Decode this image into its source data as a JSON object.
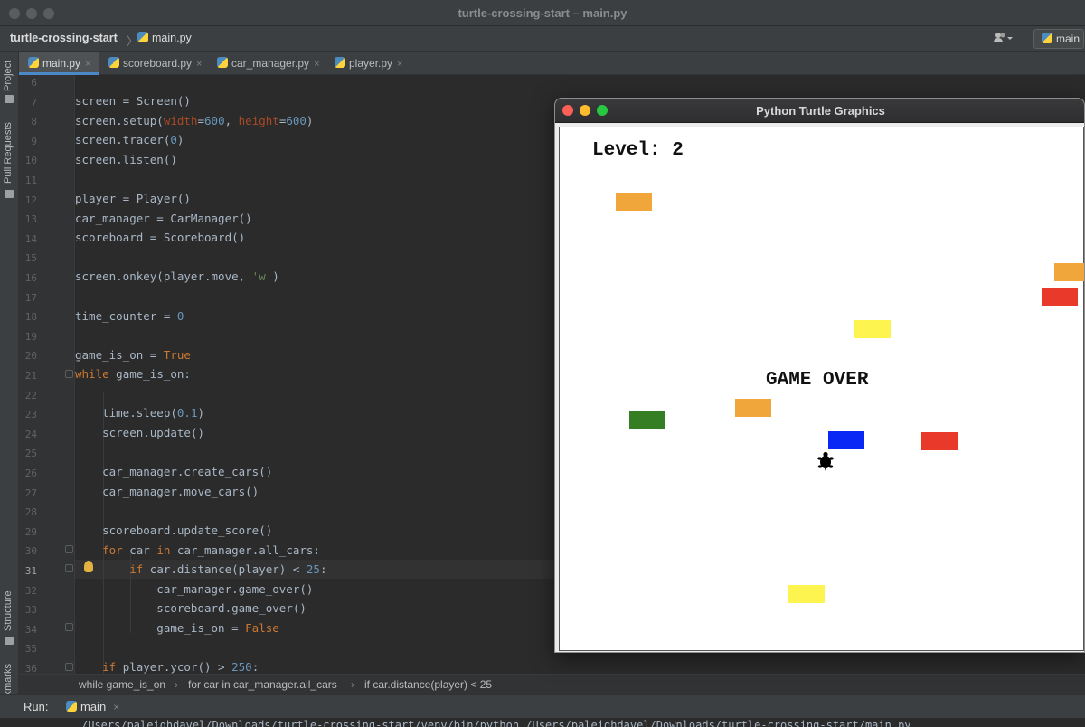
{
  "window": {
    "title": "turtle-crossing-start – main.py"
  },
  "navbar": {
    "project": "turtle-crossing-start",
    "file": "main.py",
    "run_config": "main"
  },
  "tool_strip": {
    "project": "Project",
    "pull_requests": "Pull Requests",
    "structure": "Structure",
    "bookmarks": "Bookmarks"
  },
  "tabs": [
    {
      "label": "main.py",
      "close": "×"
    },
    {
      "label": "scoreboard.py",
      "close": "×"
    },
    {
      "label": "car_manager.py",
      "close": "×"
    },
    {
      "label": "player.py",
      "close": "×"
    }
  ],
  "editor": {
    "current_line": "31",
    "line_numbers": [
      "6",
      "7",
      "8",
      "9",
      "10",
      "11",
      "12",
      "13",
      "14",
      "15",
      "16",
      "17",
      "18",
      "19",
      "20",
      "21",
      "22",
      "23",
      "24",
      "25",
      "26",
      "27",
      "28",
      "29",
      "30",
      "31",
      "32",
      "33",
      "34",
      "35",
      "36"
    ]
  },
  "breadcrumbs": [
    "while game_is_on",
    "for car in car_manager.all_cars",
    "if car.distance(player) < 25"
  ],
  "run": {
    "label": "Run:",
    "config": "main",
    "close": "×",
    "console": "/Users/paleighdavel/Downloads/turtle-crossing-start/venv/bin/python /Users/paleighdavel/Downloads/turtle-crossing-start/main.py"
  },
  "turtle_window": {
    "title": "Python Turtle Graphics",
    "level_text": "Level: 2",
    "game_over_text": "GAME OVER",
    "cars": [
      {
        "color": "#f0a63a"
      },
      {
        "color": "#f0a63a"
      },
      {
        "color": "#e8392a"
      },
      {
        "color": "#fdf44f"
      },
      {
        "color": "#f0a63a"
      },
      {
        "color": "#367e23"
      },
      {
        "color": "#0a28f5"
      },
      {
        "color": "#e8392a"
      },
      {
        "color": "#fdf44f"
      }
    ],
    "player_icon": "turtle-icon"
  },
  "colors": {
    "keyword": "#cc7832",
    "number": "#6897bb",
    "string": "#6a8759",
    "param": "#aa4926",
    "accent": "#4a88c7"
  }
}
